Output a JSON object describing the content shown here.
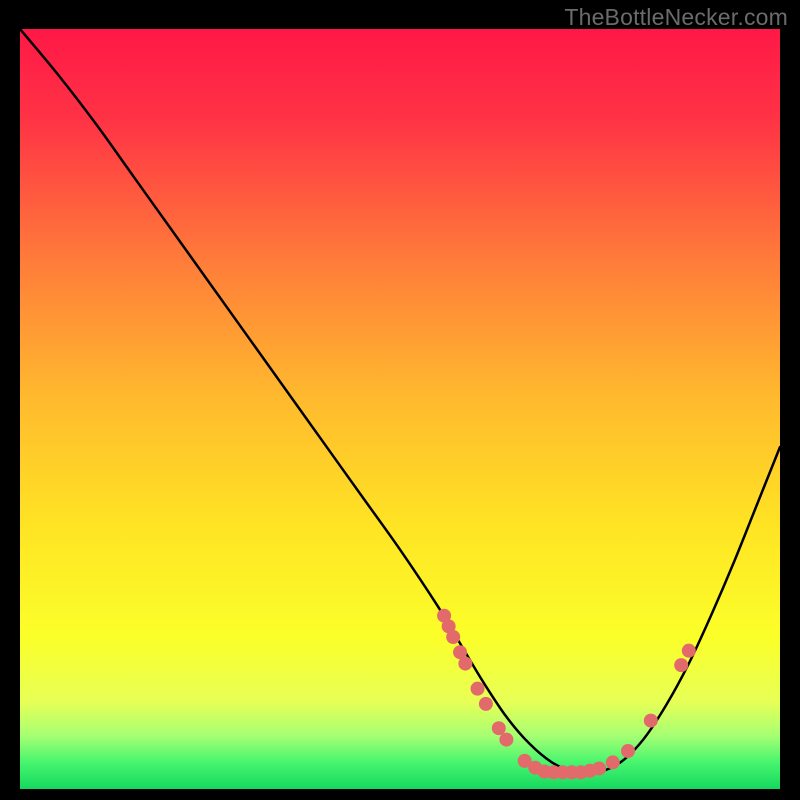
{
  "watermark": "TheBottleNecker.com",
  "gradient": {
    "stops": [
      {
        "offset": 0.0,
        "color": "#ff1846"
      },
      {
        "offset": 0.12,
        "color": "#ff3345"
      },
      {
        "offset": 0.3,
        "color": "#ff7a3a"
      },
      {
        "offset": 0.48,
        "color": "#ffb82e"
      },
      {
        "offset": 0.65,
        "color": "#ffe324"
      },
      {
        "offset": 0.8,
        "color": "#fbff29"
      },
      {
        "offset": 0.885,
        "color": "#e7ff56"
      },
      {
        "offset": 0.93,
        "color": "#a6ff73"
      },
      {
        "offset": 0.965,
        "color": "#47f56e"
      },
      {
        "offset": 1.0,
        "color": "#16d85f"
      }
    ]
  },
  "chart_data": {
    "type": "line",
    "title": "",
    "xlabel": "",
    "ylabel": "",
    "xlim": [
      0,
      100
    ],
    "ylim": [
      0,
      100
    ],
    "series": [
      {
        "name": "curve",
        "x": [
          0,
          5,
          10,
          15,
          20,
          25,
          30,
          35,
          40,
          45,
          50,
          55,
          58,
          61,
          64,
          67,
          70,
          73,
          76,
          79,
          82,
          85,
          88,
          91,
          94,
          97,
          100
        ],
        "y": [
          100,
          94,
          87.5,
          80.5,
          73.5,
          66.5,
          59.5,
          52.5,
          45.5,
          38.5,
          31.5,
          24,
          19,
          14,
          9.5,
          6,
          3.5,
          2.2,
          2.2,
          3.5,
          6.5,
          11,
          16.5,
          23,
          30,
          37.5,
          45
        ]
      }
    ],
    "markers": [
      {
        "x": 55.8,
        "y": 22.8
      },
      {
        "x": 56.4,
        "y": 21.4
      },
      {
        "x": 57.0,
        "y": 20.0
      },
      {
        "x": 57.9,
        "y": 18.0
      },
      {
        "x": 58.6,
        "y": 16.5
      },
      {
        "x": 60.2,
        "y": 13.2
      },
      {
        "x": 61.3,
        "y": 11.2
      },
      {
        "x": 63.0,
        "y": 8.0
      },
      {
        "x": 64.0,
        "y": 6.5
      },
      {
        "x": 66.4,
        "y": 3.7
      },
      {
        "x": 67.8,
        "y": 2.8
      },
      {
        "x": 69.0,
        "y": 2.3
      },
      {
        "x": 70.2,
        "y": 2.2
      },
      {
        "x": 71.4,
        "y": 2.2
      },
      {
        "x": 72.6,
        "y": 2.2
      },
      {
        "x": 73.8,
        "y": 2.2
      },
      {
        "x": 75.0,
        "y": 2.4
      },
      {
        "x": 76.2,
        "y": 2.7
      },
      {
        "x": 78.0,
        "y": 3.5
      },
      {
        "x": 80.0,
        "y": 5.0
      },
      {
        "x": 83.0,
        "y": 9.0
      },
      {
        "x": 87.0,
        "y": 16.3
      },
      {
        "x": 88.0,
        "y": 18.2
      }
    ],
    "marker_style": {
      "color": "#e36a6a",
      "radius_px": 7
    }
  }
}
